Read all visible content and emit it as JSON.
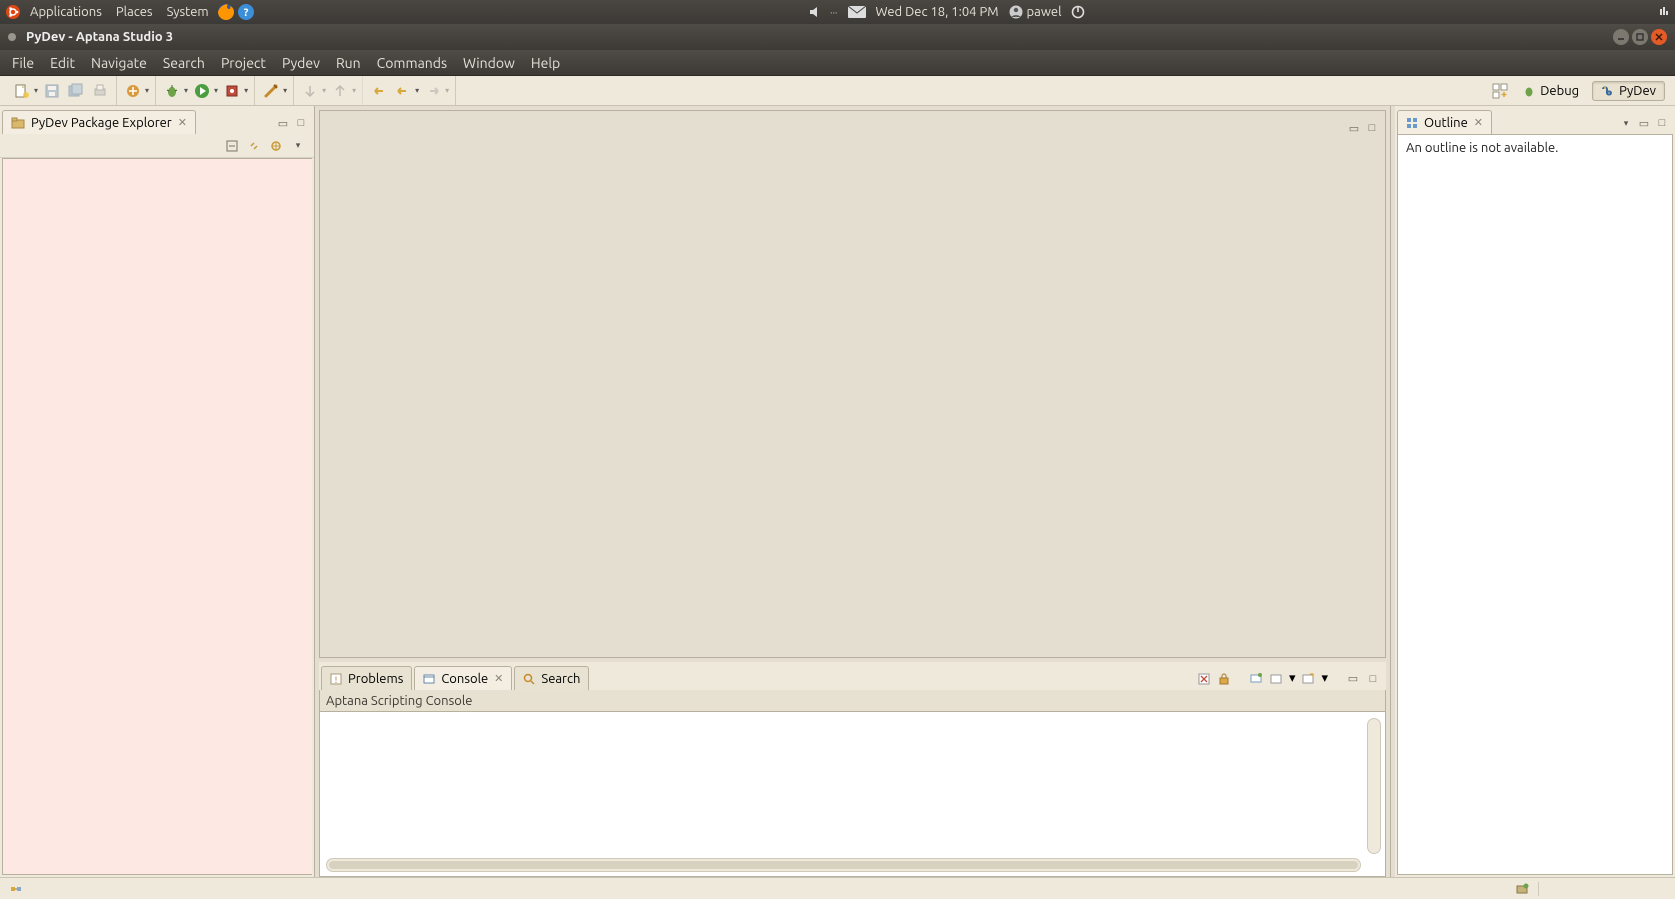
{
  "gnome": {
    "menus": [
      "Applications",
      "Places",
      "System"
    ],
    "datetime": "Wed Dec 18,  1:04 PM",
    "user": "pawel"
  },
  "window": {
    "title": "PyDev - Aptana Studio 3"
  },
  "menubar": [
    "File",
    "Edit",
    "Navigate",
    "Search",
    "Project",
    "Pydev",
    "Run",
    "Commands",
    "Window",
    "Help"
  ],
  "perspectives": {
    "debug": "Debug",
    "pydev": "PyDev"
  },
  "views": {
    "package_explorer": {
      "title": "PyDev Package Explorer"
    },
    "outline": {
      "title": "Outline",
      "body": "An outline is not available."
    }
  },
  "bottom_tabs": {
    "problems": "Problems",
    "console": "Console",
    "search": "Search"
  },
  "console": {
    "header": "Aptana Scripting Console"
  }
}
